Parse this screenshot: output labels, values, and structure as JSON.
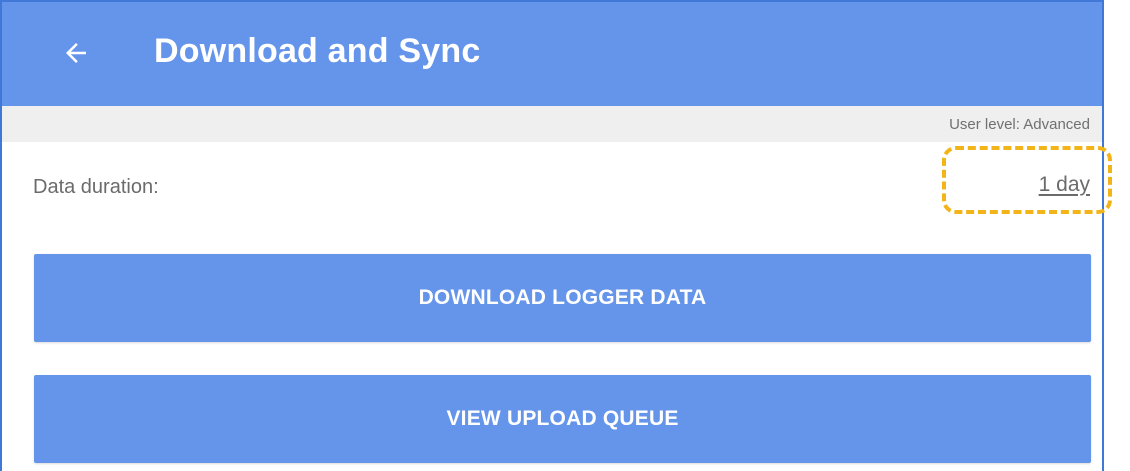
{
  "app_bar": {
    "title": "Download and Sync",
    "back_icon": "arrow-left-icon"
  },
  "status": {
    "user_level": "User level: Advanced"
  },
  "settings": {
    "duration_label": "Data duration:",
    "duration_value": "1 day"
  },
  "actions": {
    "download_label": "DOWNLOAD LOGGER DATA",
    "queue_label": "VIEW UPLOAD QUEUE"
  },
  "colors": {
    "primary": "#6595ea",
    "highlight": "#f2b416",
    "strip": "#efefef",
    "text_muted": "#6b6b6b"
  }
}
